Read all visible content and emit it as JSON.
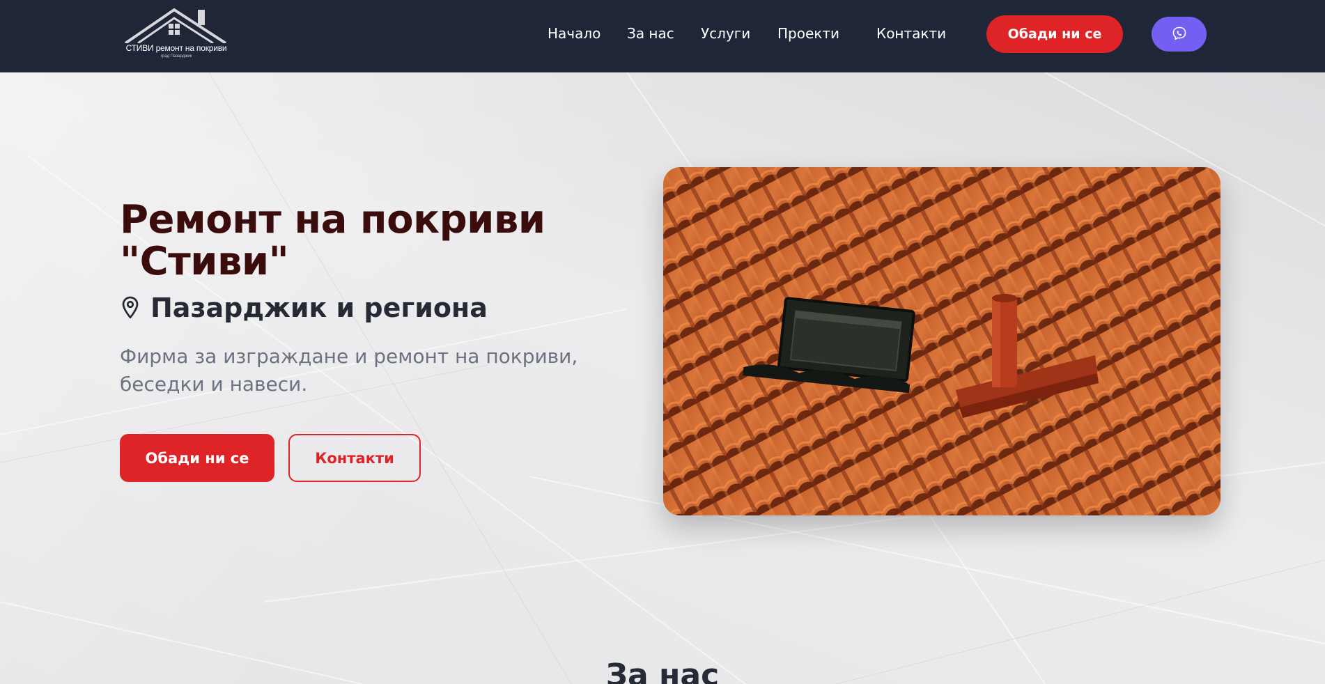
{
  "brand": {
    "name": "СТИВИ ремонт на покриви",
    "subtitle": "град Пазарджик"
  },
  "nav": {
    "items": [
      {
        "label": "Начало"
      },
      {
        "label": "За нас"
      },
      {
        "label": "Услуги"
      },
      {
        "label": "Проекти"
      },
      {
        "label": "Контакти"
      }
    ],
    "call_label": "Обади ни се",
    "viber_icon": "viber-icon"
  },
  "hero": {
    "title": "Ремонт на покриви \"Стиви\"",
    "location_icon": "map-pin-icon",
    "location": "Пазарджик и региона",
    "description": "Фирма за изграждане и ремонт на покриви, беседки и навеси.",
    "primary_button": "Обади ни се",
    "secondary_button": "Контакти",
    "image": "roof-tiles-photo"
  },
  "about": {
    "title": "За нас"
  },
  "colors": {
    "header_bg": "#1f2637",
    "accent": "#de2426",
    "viber": "#7360f2",
    "title": "#3a0c0c",
    "text_muted": "#6b7280"
  }
}
